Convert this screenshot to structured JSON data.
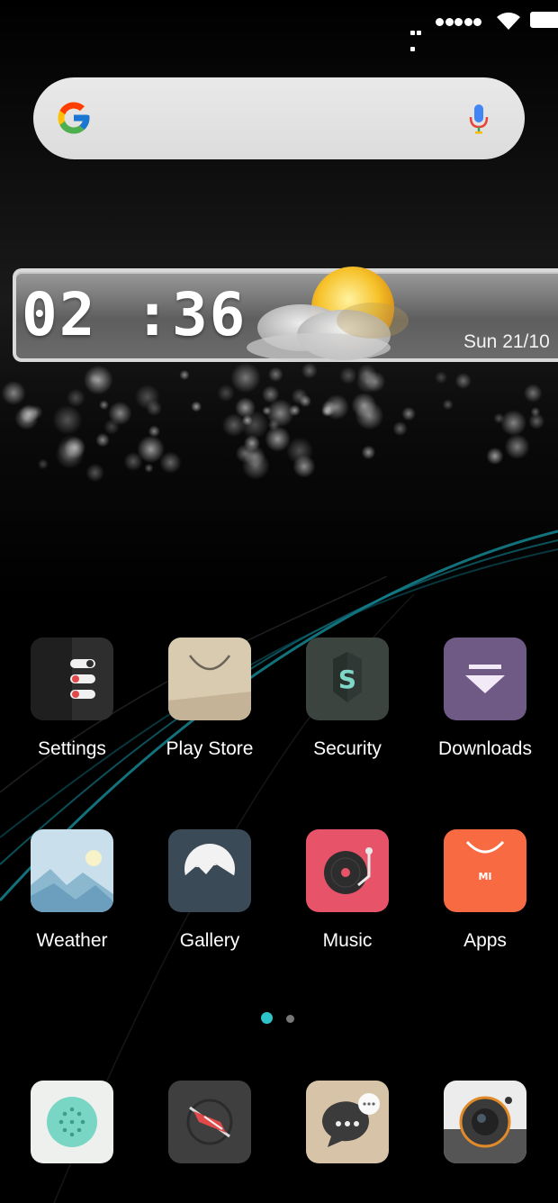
{
  "status_bar": {
    "more_icon": "more-dots-icon",
    "signal_icon": "signal-dots-icon",
    "wifi_icon": "wifi-icon",
    "battery_icon": "battery-icon"
  },
  "search_bar": {
    "logo_icon": "google-g-icon",
    "mic_icon": "microphone-icon",
    "placeholder": ""
  },
  "clock_widget": {
    "time": "02 :36",
    "date": "Sun 21/10",
    "weather_icon": "partly-cloudy-icon"
  },
  "apps": [
    {
      "label": "Settings",
      "icon": "settings-icon",
      "color": "#3b3b3b"
    },
    {
      "label": "Play Store",
      "icon": "shopping-bag-icon",
      "color": "#d8cbb0"
    },
    {
      "label": "Security",
      "icon": "shield-icon",
      "color": "#3c4440"
    },
    {
      "label": "Downloads",
      "icon": "download-arrow-icon",
      "color": "#6f5a86"
    },
    {
      "label": "Weather",
      "icon": "weather-landscape-icon",
      "color": "#c4dbe8"
    },
    {
      "label": "Gallery",
      "icon": "mountain-photo-icon",
      "color": "#3a4a57"
    },
    {
      "label": "Music",
      "icon": "turntable-icon",
      "color": "#e7546a"
    },
    {
      "label": "Apps",
      "icon": "mi-bag-icon",
      "color": "#f76a42"
    }
  ],
  "page_indicator": {
    "pages": 2,
    "active": 1
  },
  "dock": [
    {
      "icon": "phone-dialpad-icon",
      "color": "#eef0ee"
    },
    {
      "icon": "compass-browser-icon",
      "color": "#3f3f3f"
    },
    {
      "icon": "messages-icon",
      "color": "#d7c4a8"
    },
    {
      "icon": "camera-icon",
      "color": "#e8e8e8"
    }
  ],
  "accent_color": "#2ec4c7"
}
